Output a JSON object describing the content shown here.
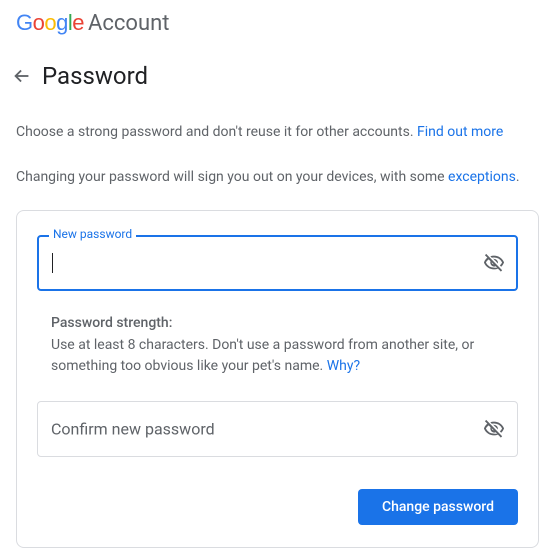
{
  "header": {
    "logo_letters": [
      "G",
      "o",
      "o",
      "g",
      "l",
      "e"
    ],
    "account_label": "Account"
  },
  "page": {
    "title": "Password",
    "intro_text": "Choose a strong password and don't reuse it for other accounts. ",
    "intro_link": "Find out more",
    "signout_text": "Changing your password will sign you out on your devices, with some ",
    "signout_link": "exceptions",
    "signout_suffix": "."
  },
  "form": {
    "new_password_label": "New password",
    "new_password_value": "",
    "confirm_label": "Confirm new password",
    "confirm_value": "",
    "strength_title": "Password strength:",
    "strength_desc": "Use at least 8 characters. Don't use a password from another site, or something too obvious like your pet's name. ",
    "strength_link": "Why?",
    "submit_label": "Change password"
  },
  "icons": {
    "back": "arrow-left",
    "visibility_off": "eye-slash"
  }
}
